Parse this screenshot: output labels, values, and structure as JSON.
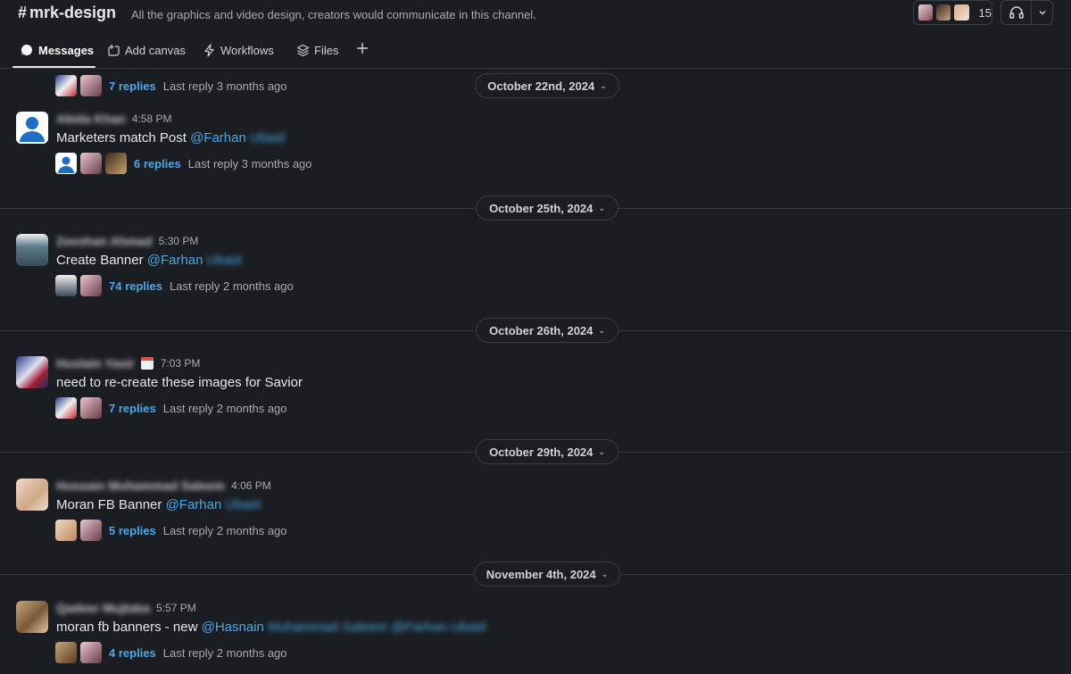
{
  "header": {
    "hash": "#",
    "channel": "mrk-design",
    "description": "All the graphics and video design, creators would communicate in this channel.",
    "member_count": "15"
  },
  "tabs": [
    {
      "label": "Messages",
      "icon": "message-bubble-icon",
      "active": true
    },
    {
      "label": "Add canvas",
      "icon": "canvas-icon"
    },
    {
      "label": "Workflows",
      "icon": "lightning-icon"
    },
    {
      "label": "Files",
      "icon": "layers-icon"
    }
  ],
  "dates": {
    "d1": "October 22nd, 2024",
    "d2": "October 25th, 2024",
    "d3": "October 26th, 2024",
    "d4": "October 29th, 2024",
    "d5": "November 4th, 2024"
  },
  "messages": {
    "m0": {
      "replies": "7 replies",
      "last": "Last reply 3 months ago"
    },
    "m1": {
      "author": "Abida Khan",
      "time": "4:58 PM",
      "text": "Marketers match Post",
      "mention": "@Farhan",
      "mention_rest": "Ubaid",
      "replies": "6 replies",
      "last": "Last reply 3 months ago"
    },
    "m2": {
      "author": "Zeeshan Ahmad",
      "time": "5:30 PM",
      "text": "Create Banner",
      "mention": "@Farhan",
      "mention_rest": "Ubaid",
      "replies": "74 replies",
      "last": "Last reply 2 months ago"
    },
    "m3": {
      "author": "Huslain Yasir",
      "time": "7:03 PM",
      "text": "need to re-create these images for Savior",
      "replies": "7 replies",
      "last": "Last reply 2 months ago"
    },
    "m4": {
      "author": "Hussain Muhammad Saleem",
      "time": "4:06 PM",
      "text": "Moran FB Banner",
      "mention": "@Farhan",
      "mention_rest": "Ubaid",
      "replies": "5 replies",
      "last": "Last reply 2 months ago"
    },
    "m5": {
      "author": "Qadeer Mujtaba",
      "time": "5:57 PM",
      "text": "moran fb banners - new",
      "mention": "@Hasnain",
      "mention_rest": "Muhammad Saleem  @Farhan Ubaid",
      "replies": "4 replies",
      "last": "Last reply 2 months ago"
    }
  },
  "colors": {
    "bg": "#1a1d21",
    "link": "#4aa8e8",
    "divider": "#34373b"
  }
}
